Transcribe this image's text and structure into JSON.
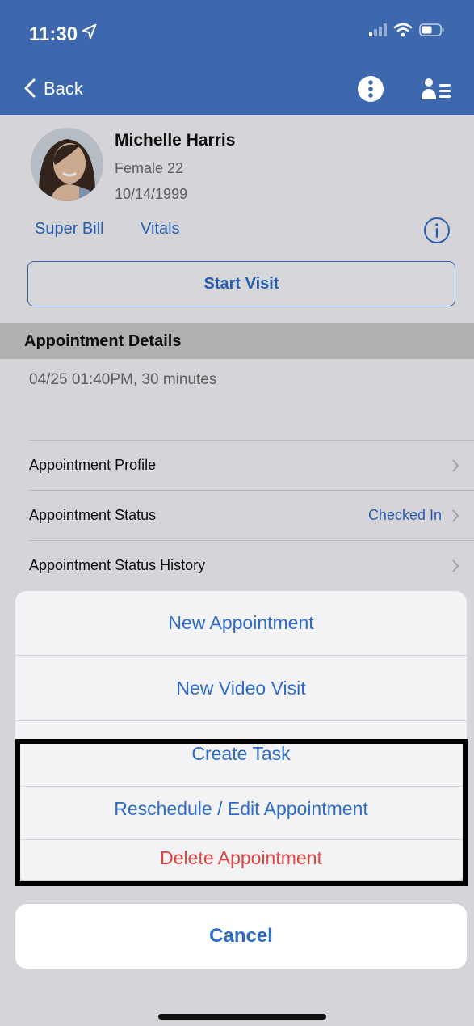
{
  "status_bar": {
    "time": "11:30"
  },
  "nav": {
    "back_label": "Back"
  },
  "patient": {
    "name": "Michelle Harris",
    "gender_age": "Female 22",
    "dob": "10/14/1999",
    "links": [
      "Super Bill",
      "Vitals"
    ],
    "start_visit_label": "Start Visit"
  },
  "appointment": {
    "section_title": "Appointment Details",
    "time": "04/25 01:40PM, 30 minutes",
    "rows": [
      {
        "label": "Appointment Profile",
        "value": ""
      },
      {
        "label": "Appointment Status",
        "value": "Checked In"
      },
      {
        "label": "Appointment Status History",
        "value": ""
      }
    ]
  },
  "action_sheet": {
    "items": [
      "New Appointment",
      "New Video Visit",
      "Create Task",
      "Reschedule / Edit Appointment",
      "Delete Appointment"
    ],
    "cancel_label": "Cancel"
  },
  "colors": {
    "header": "#3d68ad",
    "link": "#2f6cc6",
    "danger": "#e0443e"
  },
  "icons": [
    "location-arrow-icon",
    "signal-icon",
    "wifi-icon",
    "battery-icon",
    "back-chevron-icon",
    "more-icon",
    "patient-list-icon",
    "info-icon",
    "chevron-right-icon"
  ]
}
